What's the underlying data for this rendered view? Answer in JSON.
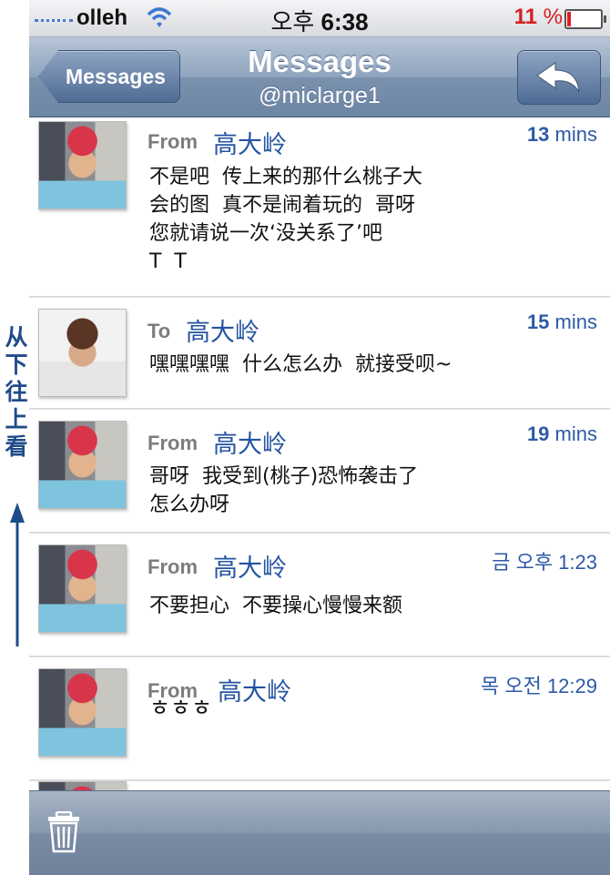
{
  "status_bar": {
    "carrier": "olleh",
    "time_prefix": "오후",
    "time": "6:38",
    "battery_number": "11",
    "battery_unit": "%",
    "battery_level": 0.11
  },
  "nav": {
    "back_label": "Messages",
    "title": "Messages",
    "subtitle": "@miclarge1"
  },
  "messages": [
    {
      "direction": "From",
      "name": "高大岭",
      "time_num": "13",
      "time_unit": "mins",
      "text": "不是吧  传上来的那什么桃子大\n会的图  真不是闹着玩的  哥呀\n您就请说一次‘没关系了’吧\nT  T"
    },
    {
      "direction": "To",
      "name": "高大岭",
      "time_num": "15",
      "time_unit": "mins",
      "text": "嘿嘿嘿嘿  什么怎么办  就接受呗~"
    },
    {
      "direction": "From",
      "name": "高大岭",
      "time_num": "19",
      "time_unit": "mins",
      "text": "哥呀  我受到(桃子)恐怖袭击了\n怎么办呀"
    },
    {
      "direction": "From",
      "name": "高大岭",
      "time_num": "",
      "time_unit": "금 오후 1:23",
      "text": "不要担心  不要操心慢慢来额"
    },
    {
      "direction": "From",
      "name": "高大岭",
      "time_num": "",
      "time_unit": "목 오전 12:29",
      "text": "ㅎㅎㅎ"
    }
  ],
  "annotation": {
    "chars": [
      "从",
      "下",
      "往",
      "上",
      "看"
    ]
  },
  "colors": {
    "name_blue": "#2454a0",
    "annotation_blue": "#1f4b8a",
    "battery_red": "#d42020"
  }
}
